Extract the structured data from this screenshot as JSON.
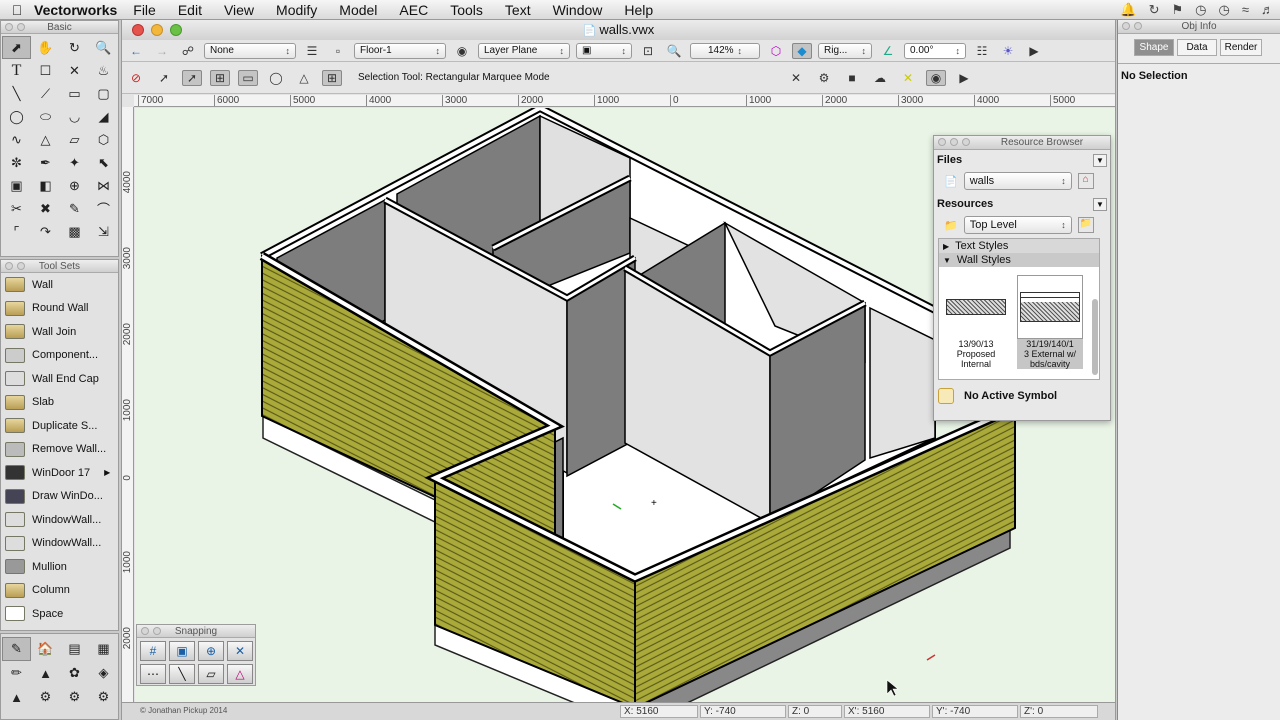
{
  "menubar": {
    "app": "Vectorworks",
    "items": [
      "File",
      "Edit",
      "View",
      "Modify",
      "Model",
      "AEC",
      "Tools",
      "Text",
      "Window",
      "Help"
    ]
  },
  "basic_palette": {
    "title": "Basic"
  },
  "toolsets_palette": {
    "title": "Tool Sets",
    "items": [
      "Wall",
      "Round Wall",
      "Wall Join",
      "Component...",
      "Wall End Cap",
      "Slab",
      "Duplicate S...",
      "Remove Wall...",
      "WinDoor 17",
      "Draw WinDo...",
      "WindowWall...",
      "WindowWall...",
      "Mullion",
      "Column",
      "Space"
    ]
  },
  "snapping_palette": {
    "title": "Snapping"
  },
  "document": {
    "title": "walls.vwx",
    "class_select": "None",
    "layer_select": "Floor-1",
    "plane_select": "Layer Plane",
    "zoom": "142%",
    "view_select": "Rig...",
    "rotation": "0.00°",
    "mode_hint": "Selection Tool: Rectangular Marquee Mode",
    "ruler_top": [
      "7000",
      "6000",
      "5000",
      "4000",
      "3000",
      "2000",
      "1000",
      "0",
      "1000",
      "2000",
      "3000",
      "4000",
      "5000"
    ],
    "ruler_left": [
      "4000",
      "3000",
      "2000",
      "1000",
      "0",
      "1000",
      "2000"
    ],
    "status": {
      "x": "X: 5160",
      "y": "Y: -740",
      "z": "Z: 0",
      "x2": "X': 5160",
      "y2": "Y': -740",
      "z2": "Z': 0"
    },
    "credit": "© Jonathan Pickup 2014"
  },
  "resource_browser": {
    "title": "Resource Browser",
    "files_label": "Files",
    "file_select": "walls",
    "resources_label": "Resources",
    "level_select": "Top Level",
    "tree": [
      "Text Styles",
      "Wall Styles"
    ],
    "thumbs": [
      {
        "line1": "13/90/13",
        "line2": "Proposed",
        "line3": "Internal"
      },
      {
        "line1": "31/19/140/1",
        "line2": "3 External w/",
        "line3": "bds/cavity"
      }
    ],
    "footer": "No Active Symbol"
  },
  "obj_info": {
    "title": "Obj Info",
    "tabs": [
      "Shape",
      "Data",
      "Render"
    ],
    "status": "No Selection"
  },
  "colors": {
    "wall_siding": "#aaaa3a",
    "wall_dark": "#7d7d7d",
    "wall_light": "#e2e2e2",
    "floor": "#ffffff",
    "canvas": "#e9f4e6"
  }
}
